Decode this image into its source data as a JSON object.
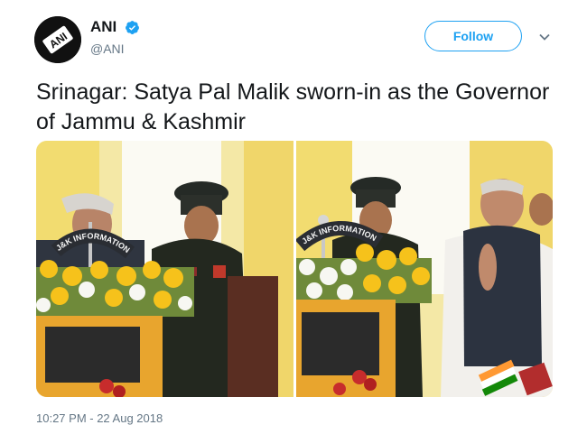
{
  "account": {
    "display_name": "ANI",
    "handle": "@ANI",
    "avatar_text": "ANI"
  },
  "actions": {
    "follow_label": "Follow"
  },
  "tweet": {
    "text": "Srinagar: Satya Pal Malik sworn-in as the Governor of Jammu & Kashmir",
    "timestamp": "10:27 PM - 22 Aug 2018"
  },
  "photos": {
    "podium_sign": "J&K INFORMATION"
  },
  "colors": {
    "accent": "#1da1f2",
    "text": "#14171a",
    "muted": "#657786"
  }
}
